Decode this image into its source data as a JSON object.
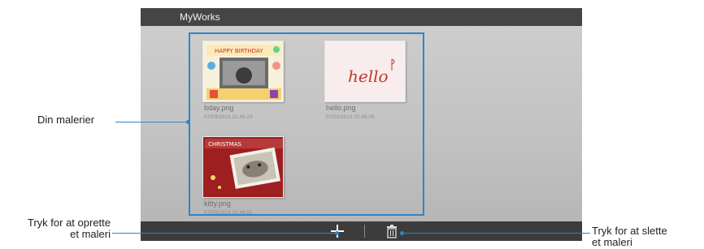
{
  "app": {
    "title": "MyWorks"
  },
  "files": [
    {
      "name": "bday.png",
      "date": "07/03/2013 02.49.23"
    },
    {
      "name": "hello.png",
      "date": "07/03/2013 02.48.05",
      "drawn_text": "hello"
    },
    {
      "name": "kitty.png",
      "date": "07/03/2013 02.48.51"
    }
  ],
  "thumb_text": {
    "bday_banner": "HAPPY BIRTHDAY",
    "kitty_banner": "CHRISTMAS"
  },
  "toolbar": {
    "add_icon": "plus-icon",
    "delete_icon": "trash-icon"
  },
  "callouts": {
    "paintings": "Din malerier",
    "create_line1": "Tryk for at oprette",
    "create_line2": "et maleri",
    "delete_line1": "Tryk for at slette",
    "delete_line2": "et maleri"
  },
  "colors": {
    "accent": "#2d86c8",
    "titlebar": "#454545",
    "bottombar": "#3c3c3c"
  }
}
